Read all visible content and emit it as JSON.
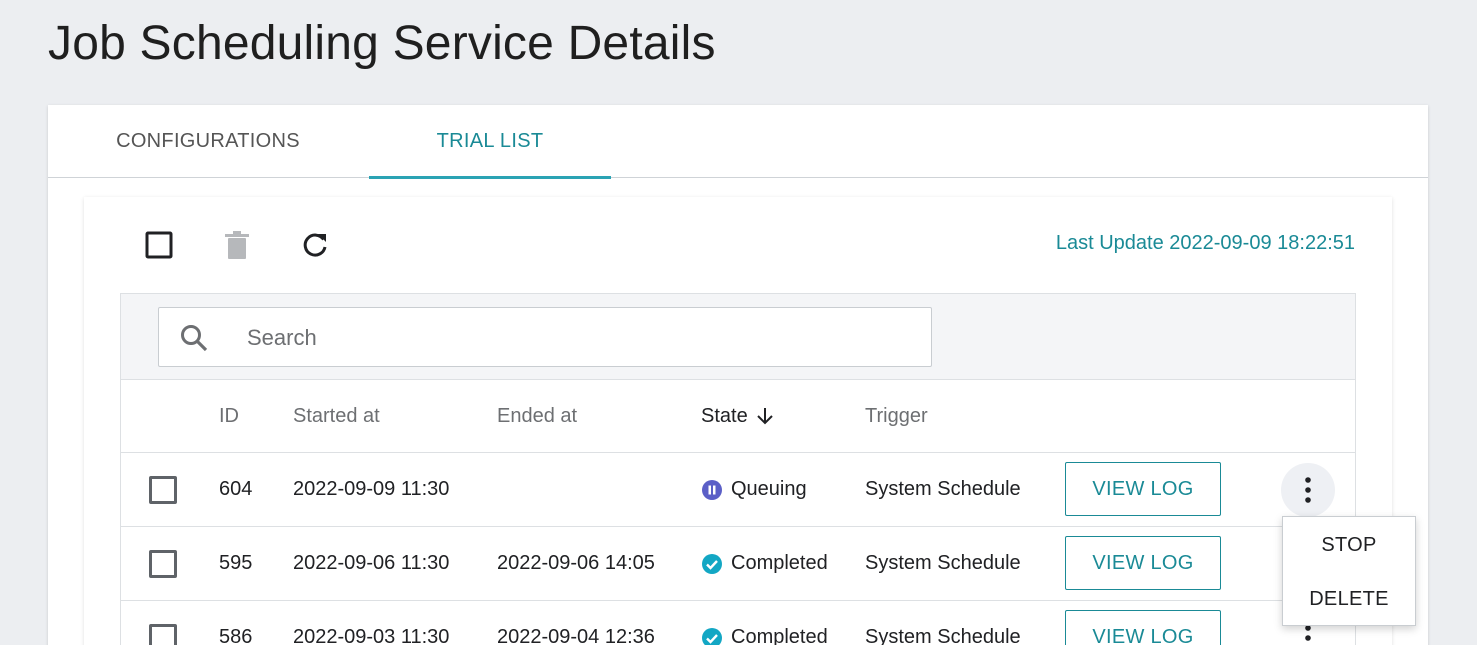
{
  "page": {
    "title": "Job Scheduling Service Details"
  },
  "tabs": [
    {
      "label": "CONFIGURATIONS"
    },
    {
      "label": "TRIAL LIST"
    }
  ],
  "toolbar": {
    "last_update_label": "Last Update 2022-09-09 18:22:51",
    "icons": [
      "checkbox-icon",
      "trash-icon",
      "refresh-icon"
    ]
  },
  "search": {
    "placeholder": "Search"
  },
  "table": {
    "headers": {
      "id": "ID",
      "started": "Started at",
      "ended": "Ended at",
      "state": "State",
      "trigger": "Trigger"
    },
    "sort": {
      "column": "State",
      "direction": "descending"
    },
    "rows": [
      {
        "id": "604",
        "started": "2022-09-09 11:30",
        "ended": "",
        "state": "Queuing",
        "state_icon": "pause-circle-icon",
        "state_color": "#5b5fc7",
        "trigger": "System Schedule",
        "action": "VIEW LOG"
      },
      {
        "id": "595",
        "started": "2022-09-06 11:30",
        "ended": "2022-09-06 14:05",
        "state": "Completed",
        "state_icon": "check-circle-icon",
        "state_color": "#13a7c4",
        "trigger": "System Schedule",
        "action": "VIEW LOG"
      },
      {
        "id": "586",
        "started": "2022-09-03 11:30",
        "ended": "2022-09-04 12:36",
        "state": "Completed",
        "state_icon": "check-circle-icon",
        "state_color": "#13a7c4",
        "trigger": "System Schedule",
        "action": "VIEW LOG"
      }
    ]
  },
  "context_menu": {
    "items": [
      {
        "label": "STOP"
      },
      {
        "label": "DELETE"
      }
    ]
  },
  "colors": {
    "accent": "#1a8a96",
    "tab_underline": "#2aa3b4",
    "background": "#eceef1"
  }
}
